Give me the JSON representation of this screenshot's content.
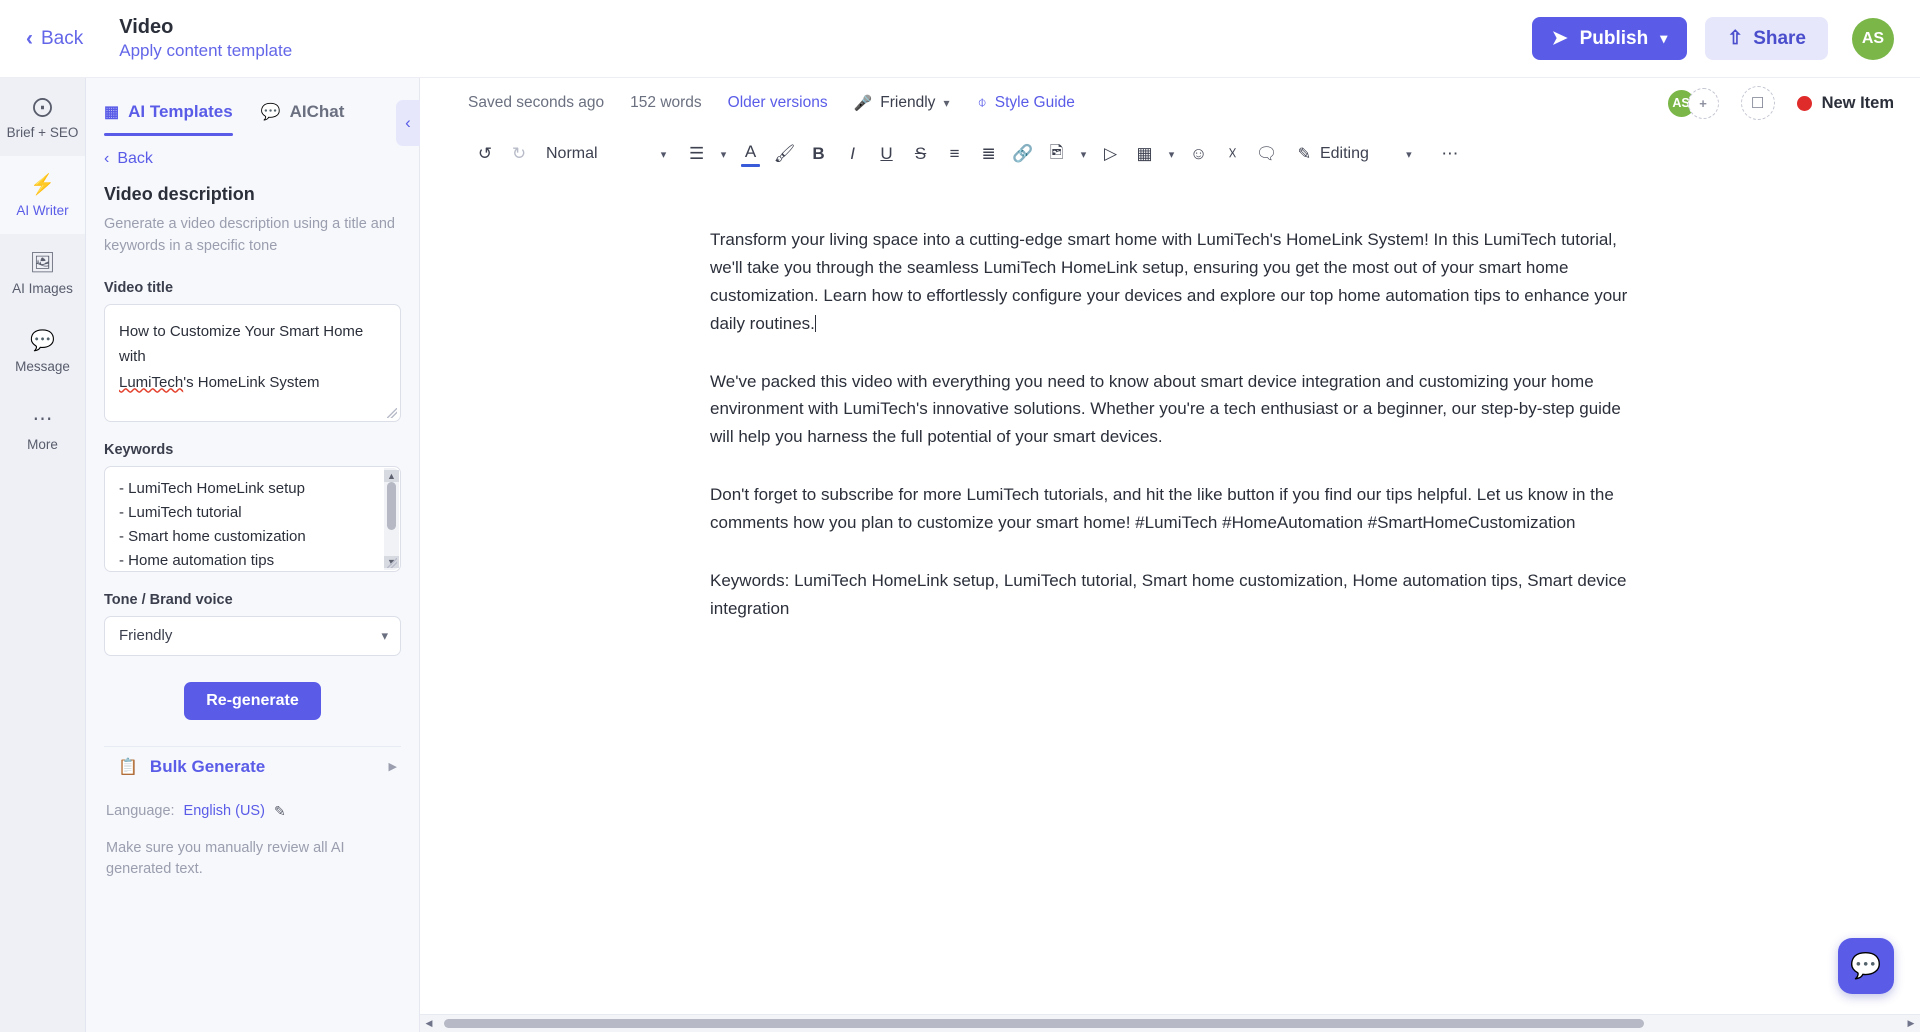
{
  "header": {
    "back_label": "Back",
    "title": "Video",
    "subtitle": "Apply content template",
    "publish_label": "Publish",
    "share_label": "Share",
    "avatar_initials": "AS",
    "accent_color": "#5a5ce8",
    "avatar_color": "#7ab648"
  },
  "rail": {
    "items": [
      {
        "label": "Brief + SEO",
        "icon": "target-icon",
        "active": false
      },
      {
        "label": "AI Writer",
        "icon": "lightning-icon",
        "active": true
      },
      {
        "label": "AI Images",
        "icon": "image-icon",
        "active": false
      },
      {
        "label": "Message",
        "icon": "chat-bubble-icon",
        "active": false
      },
      {
        "label": "More",
        "icon": "ellipsis-icon",
        "active": false
      }
    ]
  },
  "panel": {
    "tabs": [
      {
        "label": "AI Templates",
        "icon": "grid-icon",
        "active": true
      },
      {
        "label": "AIChat",
        "icon": "chat-icon",
        "active": false
      }
    ],
    "back_label": "Back",
    "template_title": "Video description",
    "template_desc": "Generate a video description using a title and keywords in a specific tone",
    "video_title_label": "Video title",
    "video_title_line1": "How to Customize Your Smart Home with",
    "video_title_line2_pre": "LumiTech",
    "video_title_line2_post": "'s HomeLink System",
    "keywords_label": "Keywords",
    "keywords": [
      "- LumiTech HomeLink setup",
      "- LumiTech tutorial",
      "- Smart home customization",
      "- Home automation tips"
    ],
    "tone_label": "Tone / Brand voice",
    "tone_value": "Friendly",
    "regenerate_label": "Re-generate",
    "bulk_generate_label": "Bulk Generate",
    "language_prefix": "Language:",
    "language_value": "English (US)",
    "disclaimer": "Make sure you manually review all AI generated text."
  },
  "meta": {
    "saved": "Saved seconds ago",
    "words": "152 words",
    "older_versions": "Older versions",
    "tone": "Friendly",
    "style_guide": "Style Guide",
    "avatar_initials": "AS",
    "avatar_add": "+",
    "new_item_label": "New Item"
  },
  "toolbar": {
    "undo": "undo-icon",
    "redo": "redo-icon",
    "style_value": "Normal",
    "align": "align-left-icon",
    "text_color": "A",
    "highlight": "highlighter-icon",
    "bold": "B",
    "italic": "I",
    "underline": "U",
    "strikethrough": "S",
    "bullet_list": "bulleted-list-icon",
    "numbered_list": "numbered-list-icon",
    "link": "link-icon",
    "image": "image-icon",
    "video": "play-icon",
    "table": "table-icon",
    "emoji": "emoji-icon",
    "clear_format": "clear-format-icon",
    "comment": "comment-icon",
    "editing_label": "Editing",
    "more": "ellipsis-icon"
  },
  "document": {
    "paragraphs": [
      "Transform your living space into a cutting-edge smart home with LumiTech's HomeLink System! In this LumiTech tutorial, we'll take you through the seamless LumiTech HomeLink setup, ensuring you get the most out of your smart home customization. Learn how to effortlessly configure your devices and explore our top home automation tips to enhance your daily routines.",
      "We've packed this video with everything you need to know about smart device integration and customizing your home environment with LumiTech's innovative solutions. Whether you're a tech enthusiast or a beginner, our step-by-step guide will help you harness the full potential of your smart devices.",
      "Don't forget to subscribe for more LumiTech tutorials, and hit the like button if you find our tips helpful. Let us know in the comments how you plan to customize your smart home! #LumiTech #HomeAutomation #SmartHomeCustomization",
      "Keywords: LumiTech HomeLink setup, LumiTech tutorial, Smart home customization, Home automation tips, Smart device integration"
    ]
  },
  "chat_fab": {
    "icon": "chat-bubble-icon"
  }
}
